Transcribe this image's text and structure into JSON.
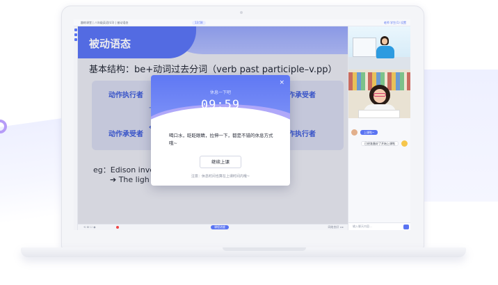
{
  "topbar": {
    "title": "趣练课堂 | 八年级英语(U3) | 被动语态",
    "timer": "13:58",
    "right": "老师  学生(1)  设置"
  },
  "slide": {
    "title": "被动语态",
    "structure": "基本结构：be+动词过去分词（verb past participle–v.pp）",
    "boxes": {
      "left_top": "动作执行者",
      "left_bottom": "动作承受者",
      "right_top": "动作承受者",
      "right_bottom": "动作执行者"
    },
    "eg_line1": "eg：Edison inve",
    "eg_line2": "➔ The ligh"
  },
  "modal": {
    "subtitle": "休息一下吧",
    "timer": "09:59",
    "close": "×",
    "message": "喝口水，眨眨眼睛，拉伸一下，都是不错的休息方式哦~",
    "button": "继续上课",
    "note": "注意：休息时间也算在上课时间内哦~"
  },
  "bottombar": {
    "left": "⟲  ⊞  ☐  ◉",
    "mid": "课程进度",
    "right": "网络良好  ◂ ▸"
  },
  "chat": {
    "bubble_blue": "上课啦~",
    "bubble_white": "已经准备好了开始上课啦",
    "input_placeholder": "输入聊天内容..."
  },
  "colors": {
    "accent": "#5a74f2",
    "modal_gradient_top": "#5f78f3",
    "slide_text_blue": "#3d5bd6"
  }
}
